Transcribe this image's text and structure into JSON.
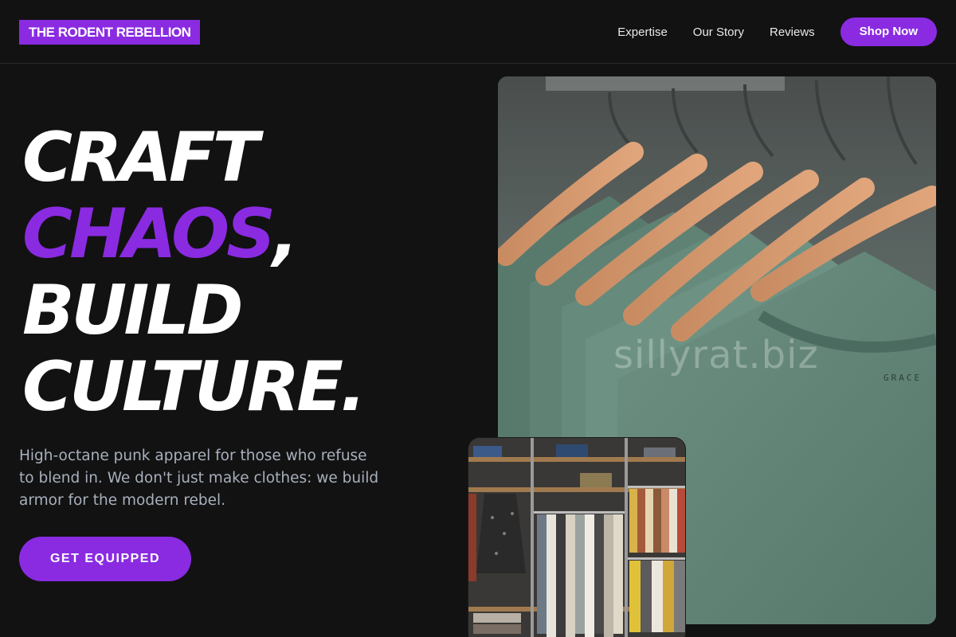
{
  "header": {
    "logo": "THE RODENT REBELLION",
    "nav": [
      "Expertise",
      "Our Story",
      "Reviews"
    ],
    "cta": "Shop Now"
  },
  "hero": {
    "line1": "CRAFT",
    "line2_accent": "CHAOS",
    "line2_rest": ",",
    "line3": "BUILD",
    "line4": "CULTURE.",
    "subtext": "High-octane punk apparel for those who refuse to blend in. We don't just make clothes: we build armor for the modern rebel.",
    "cta": "GET EQUIPPED"
  },
  "images": {
    "main_watermark": "sillyrat.biz",
    "main_tag": "GRACE"
  },
  "colors": {
    "accent": "#8a2be2",
    "background": "#121212",
    "subtext": "#a8b0bd"
  }
}
